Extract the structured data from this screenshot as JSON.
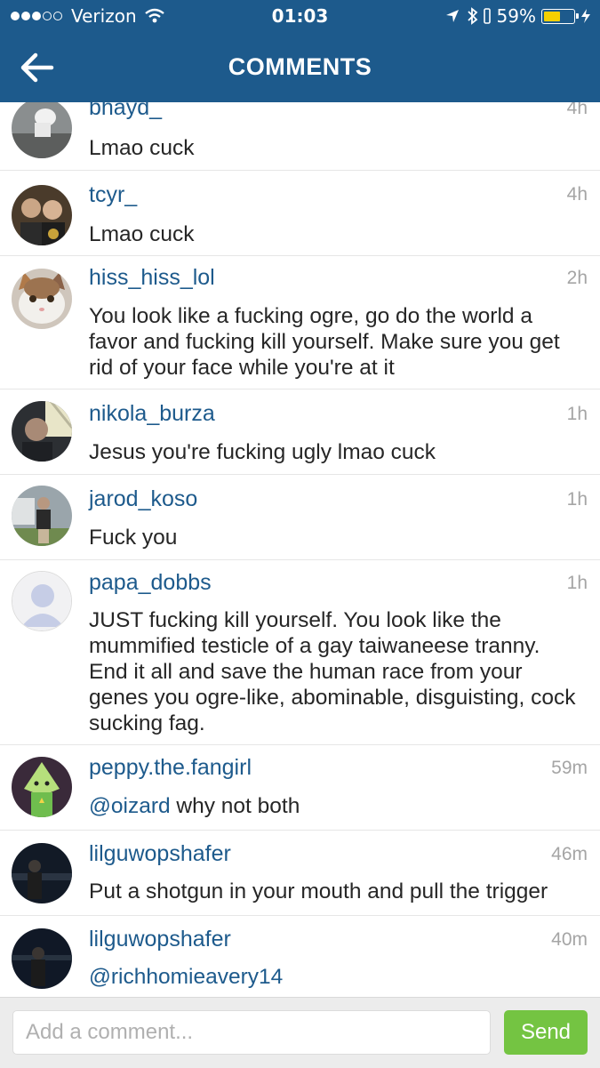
{
  "status": {
    "carrier": "Verizon",
    "signal_bars_filled": 3,
    "signal_bars_total": 5,
    "time": "01:03",
    "battery_percent_label": "59%",
    "battery_level": 0.59
  },
  "header": {
    "title": "COMMENTS"
  },
  "comments": [
    {
      "username": "bhayd_",
      "time": "4h",
      "text": "Lmao cuck"
    },
    {
      "username": "tcyr_",
      "time": "4h",
      "text": "Lmao cuck"
    },
    {
      "username": "hiss_hiss_lol",
      "time": "2h",
      "text": "You look like a fucking ogre, go do the world a favor and fucking kill yourself. Make sure you get rid of your face while you're at it"
    },
    {
      "username": "nikola_burza",
      "time": "1h",
      "text": "Jesus you're fucking ugly lmao cuck"
    },
    {
      "username": "jarod_koso",
      "time": "1h",
      "text": "Fuck you"
    },
    {
      "username": "papa_dobbs",
      "time": "1h",
      "text": "JUST fucking kill yourself. You look like the mummified testicle of a gay taiwaneese tranny. End it all and save the human race from your genes you ogre-like, abominable, disguisting, cock sucking fag."
    },
    {
      "username": "peppy.the.fangirl",
      "time": "59m",
      "mention": "@oizard",
      "text": " why not both"
    },
    {
      "username": "lilguwopshafer",
      "time": "46m",
      "text": "Put a shotgun in your mouth and pull the trigger"
    },
    {
      "username": "lilguwopshafer",
      "time": "40m",
      "mention": "@richhomieavery14",
      "text": ""
    }
  ],
  "composer": {
    "placeholder": "Add a comment...",
    "send_label": "Send"
  },
  "colors": {
    "header_blue": "#1d5a8c",
    "username_blue": "#1d5a8c",
    "send_green": "#74c442",
    "battery_yellow": "#f5d000"
  }
}
